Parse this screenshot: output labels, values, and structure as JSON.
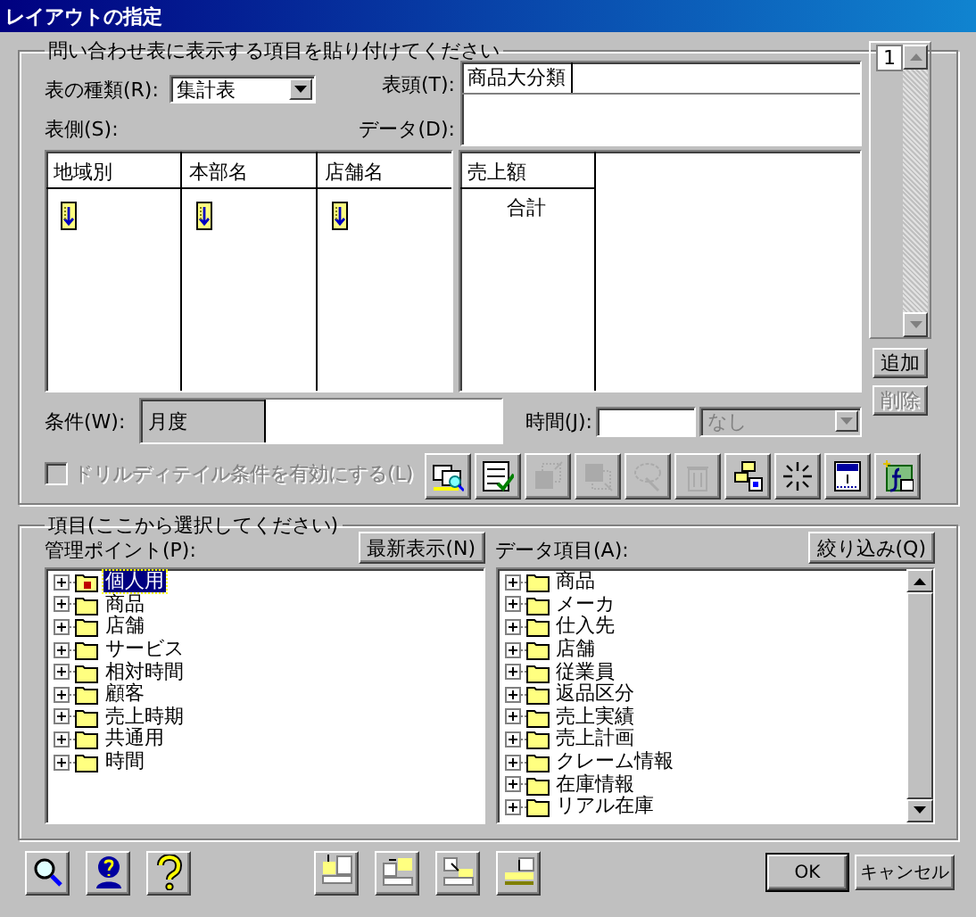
{
  "window": {
    "title": "レイアウトの指定"
  },
  "layout_group": {
    "legend": "問い合わせ表に表示する項目を貼り付けてください",
    "table_type": {
      "label": "表の種類(R):",
      "value": "集計表"
    },
    "header": {
      "label": "表頭(T):",
      "items": [
        "商品大分類"
      ]
    },
    "side_label": "表側(S):",
    "data_label": "データ(D):",
    "side_columns": [
      {
        "name": "地域別"
      },
      {
        "name": "本部名"
      },
      {
        "name": "店舗名"
      }
    ],
    "data_columns": [
      {
        "name": "売上額",
        "items": [
          "合計"
        ]
      }
    ],
    "page_number": "1",
    "add_button": {
      "label": "追加",
      "disabled": false
    },
    "delete_button": {
      "label": "削除",
      "disabled": true
    },
    "condition": {
      "label": "条件(W):",
      "key": "月度"
    },
    "time": {
      "label": "時間(J):",
      "value": "なし",
      "disabled": true
    },
    "drill_checkbox": {
      "label": "ドリルディテイル条件を有効にする(L)",
      "checked": false,
      "disabled": true
    },
    "toolbar": [
      {
        "kind": "preview",
        "disabled": false
      },
      {
        "kind": "sql",
        "disabled": false
      },
      {
        "kind": "up",
        "disabled": true
      },
      {
        "kind": "down",
        "disabled": true
      },
      {
        "kind": "lasso",
        "disabled": true
      },
      {
        "kind": "trash",
        "disabled": true
      },
      {
        "kind": "blocks",
        "disabled": false
      },
      {
        "kind": "burst",
        "disabled": false
      },
      {
        "kind": "calendar",
        "disabled": false
      },
      {
        "kind": "function",
        "disabled": false
      }
    ]
  },
  "items_group": {
    "legend": "項目(ここから選択してください)",
    "management": {
      "label": "管理ポイント(P):",
      "button": "最新表示(N)",
      "items": [
        {
          "label": "個人用",
          "kind": "locked",
          "selected": true,
          "expanded": false
        },
        {
          "label": "商品",
          "kind": "folder",
          "selected": false,
          "expanded": false
        },
        {
          "label": "店舗",
          "kind": "folder",
          "selected": false,
          "expanded": false
        },
        {
          "label": "サービス",
          "kind": "folder",
          "selected": false,
          "expanded": false
        },
        {
          "label": "相対時間",
          "kind": "folder",
          "selected": false,
          "expanded": false
        },
        {
          "label": "顧客",
          "kind": "folder",
          "selected": false,
          "expanded": false
        },
        {
          "label": "売上時期",
          "kind": "folder",
          "selected": false,
          "expanded": false
        },
        {
          "label": "共通用",
          "kind": "folder",
          "selected": false,
          "expanded": false
        },
        {
          "label": "時間",
          "kind": "folder",
          "selected": false,
          "expanded": false
        }
      ]
    },
    "data_items": {
      "label": "データ項目(A):",
      "button": "絞り込み(Q)",
      "items": [
        {
          "label": "商品",
          "kind": "folder",
          "selected": false,
          "expanded": false
        },
        {
          "label": "メーカ",
          "kind": "folder",
          "selected": false,
          "expanded": false
        },
        {
          "label": "仕入先",
          "kind": "folder",
          "selected": false,
          "expanded": false
        },
        {
          "label": "店舗",
          "kind": "folder",
          "selected": false,
          "expanded": false
        },
        {
          "label": "従業員",
          "kind": "folder",
          "selected": false,
          "expanded": false
        },
        {
          "label": "返品区分",
          "kind": "folder",
          "selected": false,
          "expanded": false
        },
        {
          "label": "売上実績",
          "kind": "folder",
          "selected": false,
          "expanded": false
        },
        {
          "label": "売上計画",
          "kind": "folder",
          "selected": false,
          "expanded": false
        },
        {
          "label": "クレーム情報",
          "kind": "folder",
          "selected": false,
          "expanded": false
        },
        {
          "label": "在庫情報",
          "kind": "folder",
          "selected": false,
          "expanded": false
        },
        {
          "label": "リアル在庫",
          "kind": "folder",
          "selected": false,
          "expanded": false
        }
      ]
    }
  },
  "bottom_bar": {
    "tools": [
      {
        "kind": "search"
      },
      {
        "kind": "person-help"
      },
      {
        "kind": "help"
      }
    ],
    "layout_tools": [
      {
        "kind": "insert-top"
      },
      {
        "kind": "insert-right"
      },
      {
        "kind": "insert-corner"
      },
      {
        "kind": "insert-bottom"
      }
    ],
    "ok": "OK",
    "cancel": "キャンセル"
  }
}
